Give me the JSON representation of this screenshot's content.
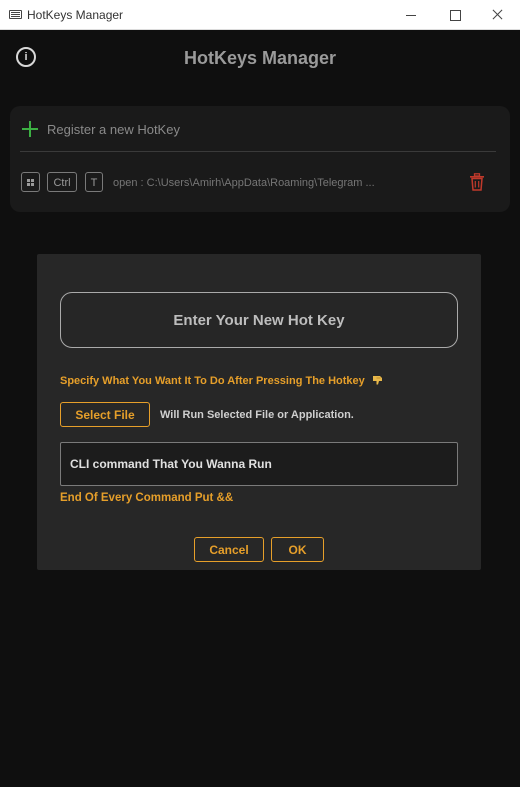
{
  "window": {
    "title": "HotKeys Manager"
  },
  "app": {
    "title": "HotKeys Manager",
    "info_icon": "info-icon",
    "info_glyph": "i"
  },
  "hotkeys_card": {
    "register_label": "Register a new HotKey",
    "register_icon": "plus-icon",
    "register_color": "#3cb043",
    "items": [
      {
        "keys": [
          "win",
          "Ctrl",
          "T"
        ],
        "command": "open : C:\\Users\\Amirh\\AppData\\Roaming\\Telegram ...",
        "delete_icon": "trash-icon",
        "delete_color": "#c0392b"
      }
    ]
  },
  "dialog": {
    "hotkey_prompt": "Enter Your New Hot Key",
    "specify_label": "Specify What You Want It To Do After Pressing The Hotkey",
    "specify_icon": "pointing-down-hand-icon",
    "select_file_label": "Select File",
    "select_file_hint": "Will Run Selected File or Application.",
    "cli_placeholder": "CLI command That You Wanna Run",
    "cli_hint": "End Of Every Command Put &&",
    "cancel_label": "Cancel",
    "ok_label": "OK",
    "accent_color": "#e69f2a"
  }
}
